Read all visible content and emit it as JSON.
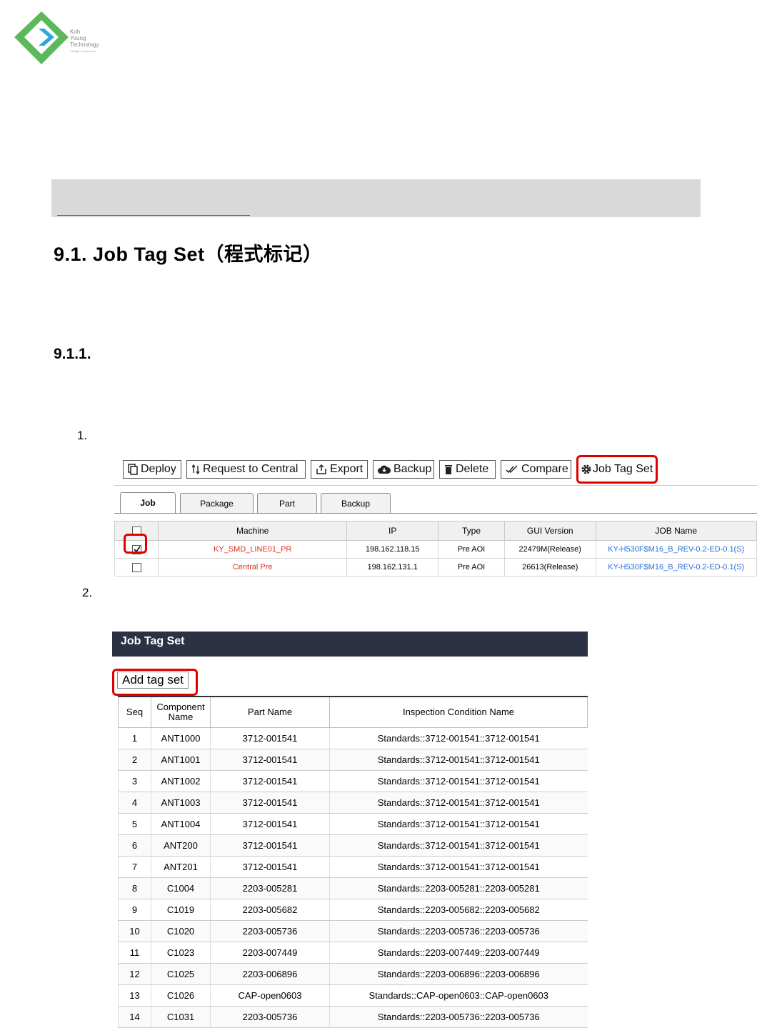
{
  "logo": {
    "brand": [
      "Koh",
      "Young",
      "Technology"
    ],
    "tagline": "intelligent inspection",
    "color": "#4caf50"
  },
  "section_heading": "9.1. Job Tag Set（程式标记）",
  "subsection_heading": "9.1.1.",
  "steps": [
    "1.",
    "2."
  ],
  "toolbar": {
    "deploy": "Deploy",
    "request": "Request to Central",
    "export": "Export",
    "backup": "Backup",
    "delete": "Delete",
    "compare": "Compare",
    "job_tag_set": "Job Tag Set"
  },
  "tabs": [
    "Job",
    "Package",
    "Part",
    "Backup"
  ],
  "jobs_table": {
    "headers": [
      "Machine",
      "IP",
      "Type",
      "GUI Version",
      "JOB Name"
    ],
    "rows": [
      {
        "checked": true,
        "machine": "KY_SMD_LINE01_PR",
        "ip": "198.162.118.15",
        "type": "Pre AOI",
        "gui": "22479M(Release)",
        "job": "KY-H530F$M16_B_REV-0.2-ED-0.1(S)"
      },
      {
        "checked": false,
        "machine": "Central Pre",
        "ip": "198.162.131.1",
        "type": "Pre AOI",
        "gui": "26613(Release)",
        "job": "KY-H530F$M16_B_REV-0.2-ED-0.1(S)"
      }
    ]
  },
  "dialog": {
    "title": "Job Tag Set",
    "add_button": "Add tag set",
    "headers": {
      "seq": "Seq",
      "component_line1": "Component",
      "component_line2": "Name",
      "part": "Part Name",
      "condition": "Inspection Condition Name"
    },
    "rows": [
      {
        "seq": "1",
        "component": "ANT1000",
        "part": "3712-001541",
        "condition": "Standards::3712-001541::3712-001541"
      },
      {
        "seq": "2",
        "component": "ANT1001",
        "part": "3712-001541",
        "condition": "Standards::3712-001541::3712-001541"
      },
      {
        "seq": "3",
        "component": "ANT1002",
        "part": "3712-001541",
        "condition": "Standards::3712-001541::3712-001541"
      },
      {
        "seq": "4",
        "component": "ANT1003",
        "part": "3712-001541",
        "condition": "Standards::3712-001541::3712-001541"
      },
      {
        "seq": "5",
        "component": "ANT1004",
        "part": "3712-001541",
        "condition": "Standards::3712-001541::3712-001541"
      },
      {
        "seq": "6",
        "component": "ANT200",
        "part": "3712-001541",
        "condition": "Standards::3712-001541::3712-001541"
      },
      {
        "seq": "7",
        "component": "ANT201",
        "part": "3712-001541",
        "condition": "Standards::3712-001541::3712-001541"
      },
      {
        "seq": "8",
        "component": "C1004",
        "part": "2203-005281",
        "condition": "Standards::2203-005281::2203-005281"
      },
      {
        "seq": "9",
        "component": "C1019",
        "part": "2203-005682",
        "condition": "Standards::2203-005682::2203-005682"
      },
      {
        "seq": "10",
        "component": "C1020",
        "part": "2203-005736",
        "condition": "Standards::2203-005736::2203-005736"
      },
      {
        "seq": "11",
        "component": "C1023",
        "part": "2203-007449",
        "condition": "Standards::2203-007449::2203-007449"
      },
      {
        "seq": "12",
        "component": "C1025",
        "part": "2203-006896",
        "condition": "Standards::2203-006896::2203-006896"
      },
      {
        "seq": "13",
        "component": "C1026",
        "part": "CAP-open0603",
        "condition": "Standards::CAP-open0603::CAP-open0603"
      },
      {
        "seq": "14",
        "component": "C1031",
        "part": "2203-005736",
        "condition": "Standards::2203-005736::2203-005736"
      }
    ]
  },
  "highlight_color": "#e00000"
}
